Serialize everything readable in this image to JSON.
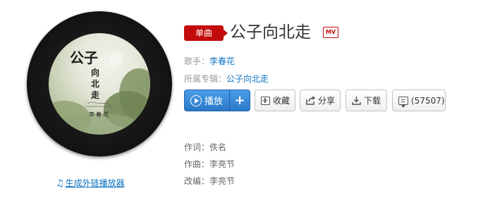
{
  "album_cover": {
    "text_title_part1": "公子",
    "text_title_part2": "向北走",
    "text_artist": "李春花"
  },
  "player_link": {
    "label": "生成外链播放器"
  },
  "header": {
    "tag_label": "单曲",
    "title": "公子向北走",
    "mv_label": "MV"
  },
  "meta": {
    "singer_label": "歌手：",
    "singer_value": "李春花",
    "album_label": "所属专辑：",
    "album_value": "公子向北走"
  },
  "actions": {
    "play_label": "播放",
    "add_label": "+",
    "favorite_label": "收藏",
    "share_label": "分享",
    "download_label": "下载",
    "comment_label": "(57507)"
  },
  "credits": {
    "lyricist": "作词：佚名",
    "composer": "作曲：李亮节",
    "arranger": "改编：李亮节"
  },
  "colors": {
    "brand_red": "#c20c0c",
    "link_blue": "#0c73c2",
    "play_blue": "#2a77c8"
  }
}
